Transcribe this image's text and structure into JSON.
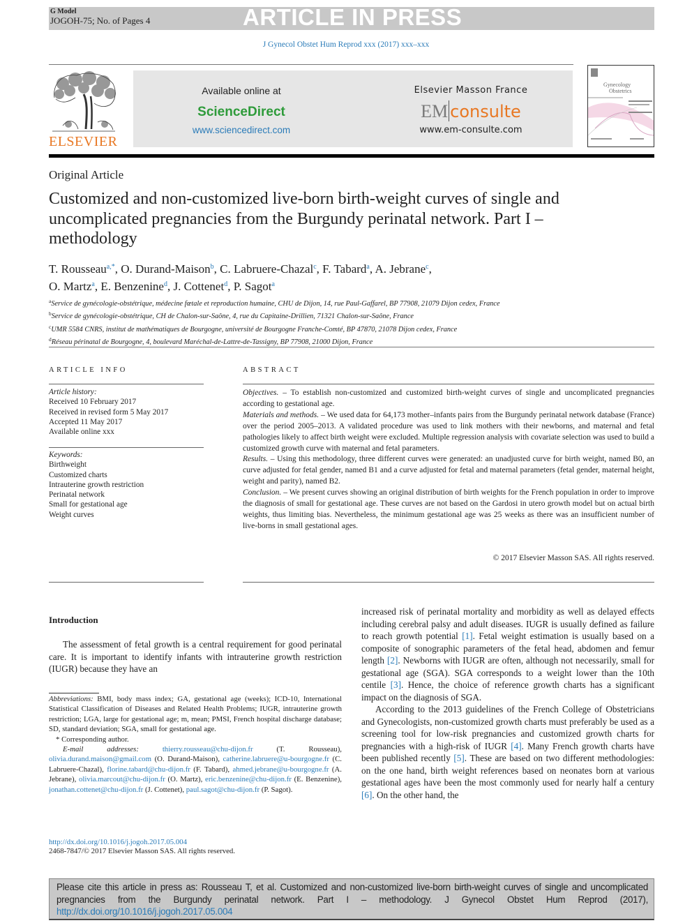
{
  "header": {
    "gmodel": "G Model",
    "ref": "JOGOH-75; No. of Pages 4",
    "banner": "ARTICLE IN PRESS",
    "journal_line": "J Gynecol Obstet Hum Reprod xxx (2017) xxx–xxx"
  },
  "logos": {
    "publisher_wordmark": "ELSEVIER",
    "available_online": "Available online at",
    "sciencedirect": "ScienceDirect",
    "sciencedirect_url": "www.sciencedirect.com",
    "masson": "Elsevier Masson France",
    "em": "EM",
    "consulte": "consulte",
    "em_url": "www.em-consulte.com",
    "cover_title_1": "Gynecology",
    "cover_title_2": "Obstetrics",
    "colors": {
      "elsevier_orange": "#e87722",
      "sciencedirect_green": "#2e9b3a",
      "link_blue": "#2a7bb8"
    }
  },
  "article": {
    "type": "Original Article",
    "title": "Customized and non-customized live-born birth-weight curves of single and uncomplicated pregnancies from the Burgundy perinatal network. Part I – methodology",
    "authors": [
      {
        "name": "T. Rousseau",
        "aff": "a,*"
      },
      {
        "name": "O. Durand-Maison",
        "aff": "b"
      },
      {
        "name": "C. Labruere-Chazal",
        "aff": "c"
      },
      {
        "name": "F. Tabard",
        "aff": "a"
      },
      {
        "name": "A. Jebrane",
        "aff": "c"
      },
      {
        "name": "O. Martz",
        "aff": "a"
      },
      {
        "name": "E. Benzenine",
        "aff": "d"
      },
      {
        "name": "J. Cottenet",
        "aff": "d"
      },
      {
        "name": "P. Sagot",
        "aff": "a"
      }
    ],
    "affiliations": [
      {
        "key": "a",
        "text": "Service de gynécologie-obstétrique, médecine fœtale et reproduction humaine, CHU de Dijon, 14, rue Paul-Gaffarel, BP 77908, 21079 Dijon cedex, France"
      },
      {
        "key": "b",
        "text": "Service de gynécologie-obstétrique, CH de Chalon-sur-Saône, 4, rue du Capitaine-Drillien, 71321 Chalon-sur-Saône, France"
      },
      {
        "key": "c",
        "text": "UMR 5584 CNRS, institut de mathématiques de Bourgogne, université de Bourgogne Franche-Comté, BP 47870, 21078 Dijon cedex, France"
      },
      {
        "key": "d",
        "text": "Réseau périnatal de Bourgogne, 4, boulevard Maréchal-de-Lattre-de-Tassigny, BP 77908, 21000 Dijon, France"
      }
    ]
  },
  "article_info": {
    "heading": "ARTICLE INFO",
    "history_label": "Article history:",
    "history": [
      "Received 10 February 2017",
      "Received in revised form 5 May 2017",
      "Accepted 11 May 2017",
      "Available online xxx"
    ],
    "keywords_label": "Keywords:",
    "keywords": [
      "Birthweight",
      "Customized charts",
      "Intrauterine growth restriction",
      "Perinatal network",
      "Small for gestational age",
      "Weight curves"
    ]
  },
  "abstract": {
    "heading": "ABSTRACT",
    "sections": [
      {
        "label": "Objectives.",
        "text": " – To establish non-customized and customized birth-weight curves of single and uncomplicated pregnancies according to gestational age."
      },
      {
        "label": "Materials and methods.",
        "text": " – We used data for 64,173 mother–infants pairs from the Burgundy perinatal network database (France) over the period 2005–2013. A validated procedure was used to link mothers with their newborns, and maternal and fetal pathologies likely to affect birth weight were excluded. Multiple regression analysis with covariate selection was used to build a customized growth curve with maternal and fetal parameters."
      },
      {
        "label": "Results.",
        "text": " – Using this methodology, three different curves were generated: an unadjusted curve for birth weight, named B0, an curve adjusted for fetal gender, named B1 and a curve adjusted for fetal and maternal parameters (fetal gender, maternal height, weight and parity), named B2."
      },
      {
        "label": "Conclusion.",
        "text": " – We present curves showing an original distribution of birth weights for the French population in order to improve the diagnosis of small for gestational age. These curves are not based on the Gardosi in utero growth model but on actual birth weights, thus limiting bias. Nevertheless, the minimum gestational age was 25 weeks as there was an insufficient number of live-borns in small gestational ages."
      }
    ],
    "copyright": "© 2017 Elsevier Masson SAS. All rights reserved."
  },
  "body": {
    "intro_heading": "Introduction",
    "intro_p1": "The assessment of fetal growth is a central requirement for good perinatal care. It is important to identify infants with intrauterine growth restriction (IUGR) because they have an",
    "col2_p1": [
      {
        "t": "increased risk of perinatal mortality and morbidity as well as delayed effects including cerebral palsy and adult diseases. IUGR is usually defined as failure to reach growth potential "
      },
      {
        "ref": "[1]"
      },
      {
        "t": ". Fetal weight estimation is usually based on a composite of sonographic parameters of the fetal head, abdomen and femur length "
      },
      {
        "ref": "[2]"
      },
      {
        "t": ". Newborns with IUGR are often, although not necessarily, small for gestational age (SGA). SGA corresponds to a weight lower than the 10th centile "
      },
      {
        "ref": "[3]"
      },
      {
        "t": ". Hence, the choice of reference growth charts has a significant impact on the diagnosis of SGA."
      }
    ],
    "col2_p2": [
      {
        "t": "According to the 2013 guidelines of the French College of Obstetricians and Gynecologists, non-customized growth charts must preferably be used as a screening tool for low-risk pregnancies and customized growth charts for pregnancies with a high-risk of IUGR "
      },
      {
        "ref": "[4]"
      },
      {
        "t": ". Many French growth charts have been published recently "
      },
      {
        "ref": "[5]"
      },
      {
        "t": ". These are based on two different methodologies: on the one hand, birth weight references based on neonates born at various gestational ages have been the most commonly used for nearly half a century "
      },
      {
        "ref": "[6]"
      },
      {
        "t": ". On the other hand, the"
      }
    ]
  },
  "footnotes": {
    "abbrev_label": "Abbreviations:",
    "abbrev_text": " BMI, body mass index; GA, gestational age (weeks); ICD-10, International Statistical Classification of Diseases and Related Health Problems; IUGR, intrauterine growth restriction; LGA, large for gestational age; m, mean; PMSI, French hospital discharge database; SD, standard deviation; SGA, small for gestational age.",
    "corresponding": "* Corresponding author.",
    "email_label": "E-mail addresses:",
    "emails": [
      {
        "email": "thierry.rousseau@chu-dijon.fr",
        "who": "(T. Rousseau)"
      },
      {
        "email": "olivia.durand.maison@gmail.com",
        "who": "(O. Durand-Maison)"
      },
      {
        "email": "catherine.labruere@u-bourgogne.fr",
        "who": "(C. Labruere-Chazal)"
      },
      {
        "email": "florine.tabard@chu-dijon.fr",
        "who": "(F. Tabard)"
      },
      {
        "email": "ahmed.jebrane@u-bourgogne.fr",
        "who": "(A. Jebrane)"
      },
      {
        "email": "olivia.marcout@chu-dijon.fr",
        "who": "(O. Martz)"
      },
      {
        "email": "eric.benzenine@chu-dijon.fr",
        "who": "(E. Benzenine)"
      },
      {
        "email": "jonathan.cottenet@chu-dijon.fr",
        "who": "(J. Cottenet)"
      },
      {
        "email": "paul.sagot@chu-dijon.fr",
        "who": "(P. Sagot)."
      }
    ],
    "doi_url": "http://dx.doi.org/10.1016/j.jogoh.2017.05.004",
    "issn": "2468-7847/© 2017 Elsevier Masson SAS. All rights reserved."
  },
  "citation": {
    "text": "Please cite this article in press as: Rousseau T, et al. Customized and non-customized live-born birth-weight curves of single and uncomplicated pregnancies from the Burgundy perinatal network. Part I – methodology. J Gynecol Obstet Hum Reprod (2017), ",
    "link": "http://dx.doi.org/10.1016/j.jogoh.2017.05.004"
  }
}
